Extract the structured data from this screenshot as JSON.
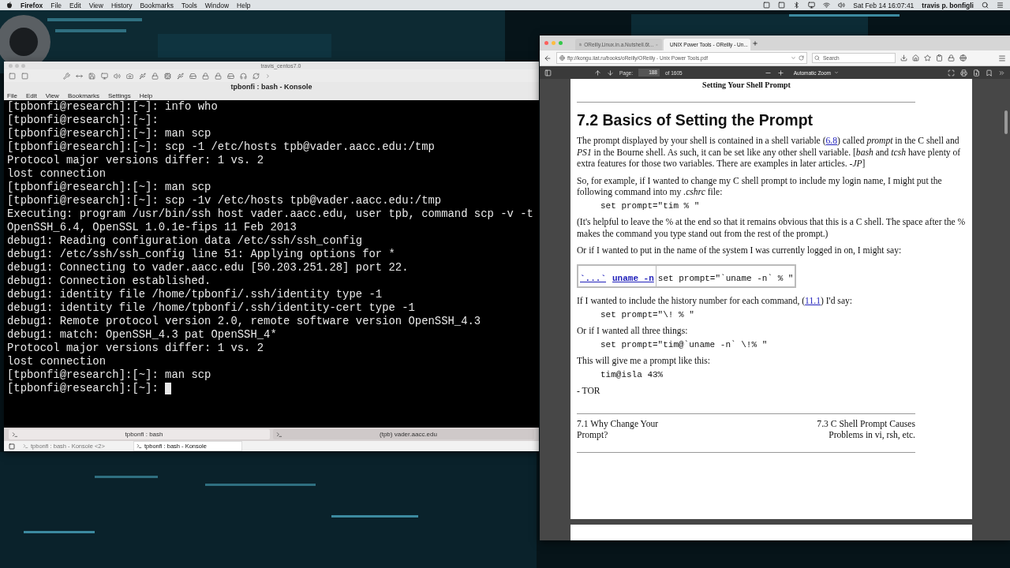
{
  "menu_bar": {
    "app": "Firefox",
    "items": [
      "File",
      "Edit",
      "View",
      "History",
      "Bookmarks",
      "Tools",
      "Window",
      "Help"
    ],
    "clock": "Sat Feb 14  16:07:41",
    "user": "travis p. bonfigli"
  },
  "konsole": {
    "vm_title": "travis_centos7.0",
    "title": "tpbonfi : bash - Konsole",
    "menu": [
      "File",
      "Edit",
      "View",
      "Bookmarks",
      "Settings",
      "Help"
    ],
    "lines": [
      "[tpbonfi@research]:[~]: info who",
      "[tpbonfi@research]:[~]:",
      "[tpbonfi@research]:[~]: man scp",
      "[tpbonfi@research]:[~]: scp -1 /etc/hosts tpb@vader.aacc.edu:/tmp",
      "Protocol major versions differ: 1 vs. 2",
      "lost connection",
      "[tpbonfi@research]:[~]: man scp",
      "[tpbonfi@research]:[~]: scp -1v /etc/hosts tpb@vader.aacc.edu:/tmp",
      "Executing: program /usr/bin/ssh host vader.aacc.edu, user tpb, command scp -v -t",
      "OpenSSH_6.4, OpenSSL 1.0.1e-fips 11 Feb 2013",
      "debug1: Reading configuration data /etc/ssh/ssh_config",
      "debug1: /etc/ssh/ssh_config line 51: Applying options for *",
      "debug1: Connecting to vader.aacc.edu [50.203.251.28] port 22.",
      "debug1: Connection established.",
      "debug1: identity file /home/tpbonfi/.ssh/identity type -1",
      "debug1: identity file /home/tpbonfi/.ssh/identity-cert type -1",
      "debug1: Remote protocol version 2.0, remote software version OpenSSH_4.3",
      "debug1: match: OpenSSH_4.3 pat OpenSSH_4*",
      "Protocol major versions differ: 1 vs. 2",
      "lost connection",
      "[tpbonfi@research]:[~]: man scp"
    ],
    "prompt": "[tpbonfi@research]:[~]:",
    "tabs": [
      {
        "label": "tpbonfi : bash",
        "selected": true
      },
      {
        "label": "(tpb) vader.aacc.edu",
        "selected": false
      }
    ],
    "taskbar": [
      {
        "label": "tpbonfi : bash - Konsole <2>",
        "selected": false
      },
      {
        "label": "tpbonfi : bash - Konsole",
        "selected": true
      }
    ]
  },
  "firefox": {
    "tabs": [
      {
        "label": "OReilly.Linux.in.a.Nutshell.6t...",
        "selected": false
      },
      {
        "label": "UNIX Power Tools - OReilly - Un...",
        "selected": true
      }
    ],
    "url": "ftp://kongu.iiat.ru/books/oReilly/OReilly - Unix Power Tools.pdf",
    "search_placeholder": "Search",
    "pdf_toolbar": {
      "page_label": "Page:",
      "page": "188",
      "page_count": "of 1605",
      "zoom": "Automatic Zoom"
    },
    "document": [
      {
        "kind": "running_head",
        "text": "Setting Your Shell Prompt"
      },
      {
        "kind": "rule"
      },
      {
        "kind": "heading",
        "text": "7.2 Basics of Setting the Prompt"
      },
      {
        "kind": "para",
        "parts": [
          {
            "text": "The prompt displayed by your shell is contained in a shell variable ("
          },
          {
            "link": "6.8"
          },
          {
            "text": ") called *prompt* in the C shell and *PS1* in the Bourne shell. As such, it can be set like any other shell variable. [*bash* and *tcsh* have plenty of extra features for those two variables. There are examples in later articles. -*JP*]"
          }
        ]
      },
      {
        "kind": "para",
        "parts": [
          {
            "text": "So, for example, if I wanted to change my C shell prompt to include my login name, I might put the following command into my *.cshrc* file:"
          }
        ]
      },
      {
        "kind": "code",
        "text": "set prompt=\"tim % \""
      },
      {
        "kind": "para",
        "parts": [
          {
            "text": "(It's helpful to leave the % at the end so that it remains obvious that this is a C shell. The space after the % makes the command you type stand out from the rest of the prompt.)"
          }
        ]
      },
      {
        "kind": "para",
        "parts": [
          {
            "text": "Or if I wanted to put in the name of the system I was currently logged in on, I might say:"
          }
        ]
      },
      {
        "kind": "table",
        "links": [
          "`...`",
          "uname -n"
        ],
        "code": "set prompt=\"`uname -n` % \""
      },
      {
        "kind": "para",
        "parts": [
          {
            "text": "If I wanted to include the history number for each command, ("
          },
          {
            "link": "11.1"
          },
          {
            "text": ") I'd say:"
          }
        ]
      },
      {
        "kind": "code",
        "text": "set prompt=\"\\! % \""
      },
      {
        "kind": "para",
        "parts": [
          {
            "text": "Or if I wanted all three things:"
          }
        ]
      },
      {
        "kind": "code",
        "text": "set prompt=\"tim@`uname -n` \\!% \""
      },
      {
        "kind": "para",
        "parts": [
          {
            "text": "This will give me a prompt like this:"
          }
        ]
      },
      {
        "kind": "code",
        "text": "tim@isla 43%"
      },
      {
        "kind": "para",
        "parts": [
          {
            "text": "- TOR"
          }
        ]
      },
      {
        "kind": "rule"
      },
      {
        "kind": "nav",
        "prev": "7.1 Why Change Your Prompt?",
        "next": "7.3 C Shell Prompt Causes Problems in vi, rsh, etc."
      },
      {
        "kind": "rule"
      }
    ]
  }
}
